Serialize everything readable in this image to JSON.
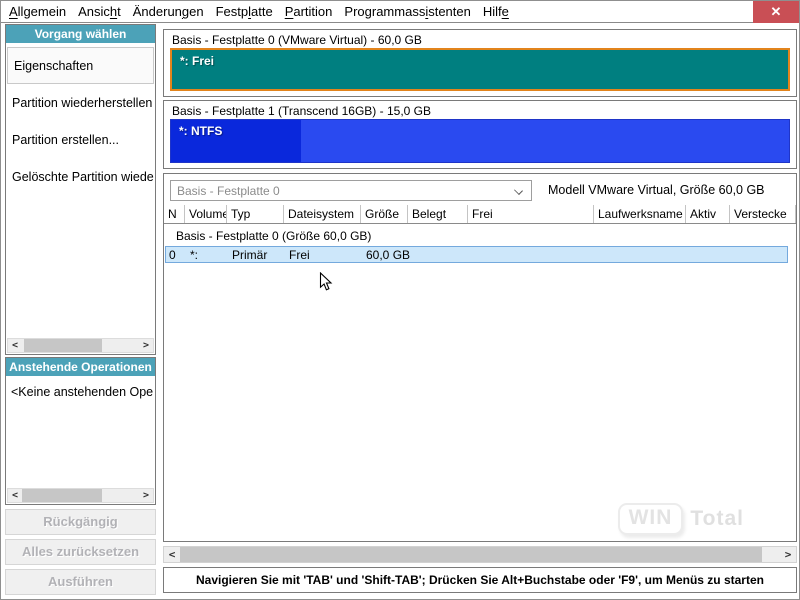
{
  "menubar": {
    "items": [
      {
        "label": "Allgemein",
        "mnemonic_index": 0
      },
      {
        "label": "Ansicht",
        "mnemonic_index": 5
      },
      {
        "label": "Änderungen",
        "mnemonic_index": 7
      },
      {
        "label": "Festplatte",
        "mnemonic_index": 5
      },
      {
        "label": "Partition",
        "mnemonic_index": 0
      },
      {
        "label": "Programmassistenten",
        "mnemonic_index": 11
      },
      {
        "label": "Hilfe",
        "mnemonic_index": 4
      }
    ],
    "close_icon": "✕"
  },
  "sidebar": {
    "action_panel": {
      "title": "Vorgang wählen",
      "items": [
        {
          "label": "Eigenschaften",
          "selected": true
        },
        {
          "label": "Partition wiederherstellen",
          "selected": false
        },
        {
          "label": "Partition erstellen...",
          "selected": false
        },
        {
          "label": "Gelöschte Partition wiede",
          "selected": false
        }
      ],
      "scroll_thumb": {
        "left_pct": 2,
        "width_pct": 66
      }
    },
    "pending_panel": {
      "title": "Anstehende Operationen",
      "empty_text": "<Keine anstehenden Ope",
      "scroll_thumb": {
        "left_pct": 0,
        "width_pct": 68
      }
    },
    "buttons": [
      {
        "label": "Rückgängig",
        "enabled": false
      },
      {
        "label": "Alles zurücksetzen",
        "enabled": false
      },
      {
        "label": "Ausführen",
        "enabled": false
      }
    ],
    "scroll_arrows": {
      "left": "<",
      "right": ">"
    }
  },
  "disks": [
    {
      "title": "Basis -  Festplatte 0 (VMware Virtual) - 60,0 GB",
      "partition_label": "*: Frei",
      "fill_color": "#007f80",
      "selected": true,
      "selected_border_color": "#e2841c",
      "used_percent": 0
    },
    {
      "title": "Basis -  Festplatte 1 (Transcend 16GB) - 15,0 GB",
      "partition_label": "*: NTFS",
      "fill_color": "#2a4af0",
      "selected": false,
      "used_color": "#0a28dc",
      "used_percent": 21
    }
  ],
  "detail": {
    "disk_selector_value": "Basis - Festplatte 0",
    "model_text": "Modell VMware Virtual, Größe 60,0 GB",
    "table": {
      "columns": [
        {
          "label": "N",
          "width": 21
        },
        {
          "label": "Volume",
          "width": 42
        },
        {
          "label": "Typ",
          "width": 57
        },
        {
          "label": "Dateisystem",
          "width": 77
        },
        {
          "label": "Größe",
          "width": 47
        },
        {
          "label": "Belegt",
          "width": 60
        },
        {
          "label": "Frei",
          "width": 126
        },
        {
          "label": "Laufwerksname",
          "width": 92
        },
        {
          "label": "Aktiv",
          "width": 44
        },
        {
          "label": "Verstecke",
          "width": 66
        }
      ],
      "group_row": "Basis -  Festplatte 0 (Größe 60,0 GB)",
      "rows": [
        {
          "selected": true,
          "cells": [
            "0",
            "*:",
            "Primär",
            "Frei",
            "60,0 GB",
            "",
            "",
            "",
            "",
            ""
          ]
        }
      ]
    },
    "watermark": {
      "box_text": "WIN",
      "text": "Total"
    }
  },
  "statusbar": {
    "text": "Navigieren Sie mit 'TAB' und 'Shift-TAB'; Drücken Sie Alt+Buchstabe oder 'F9', um Menüs zu starten"
  }
}
